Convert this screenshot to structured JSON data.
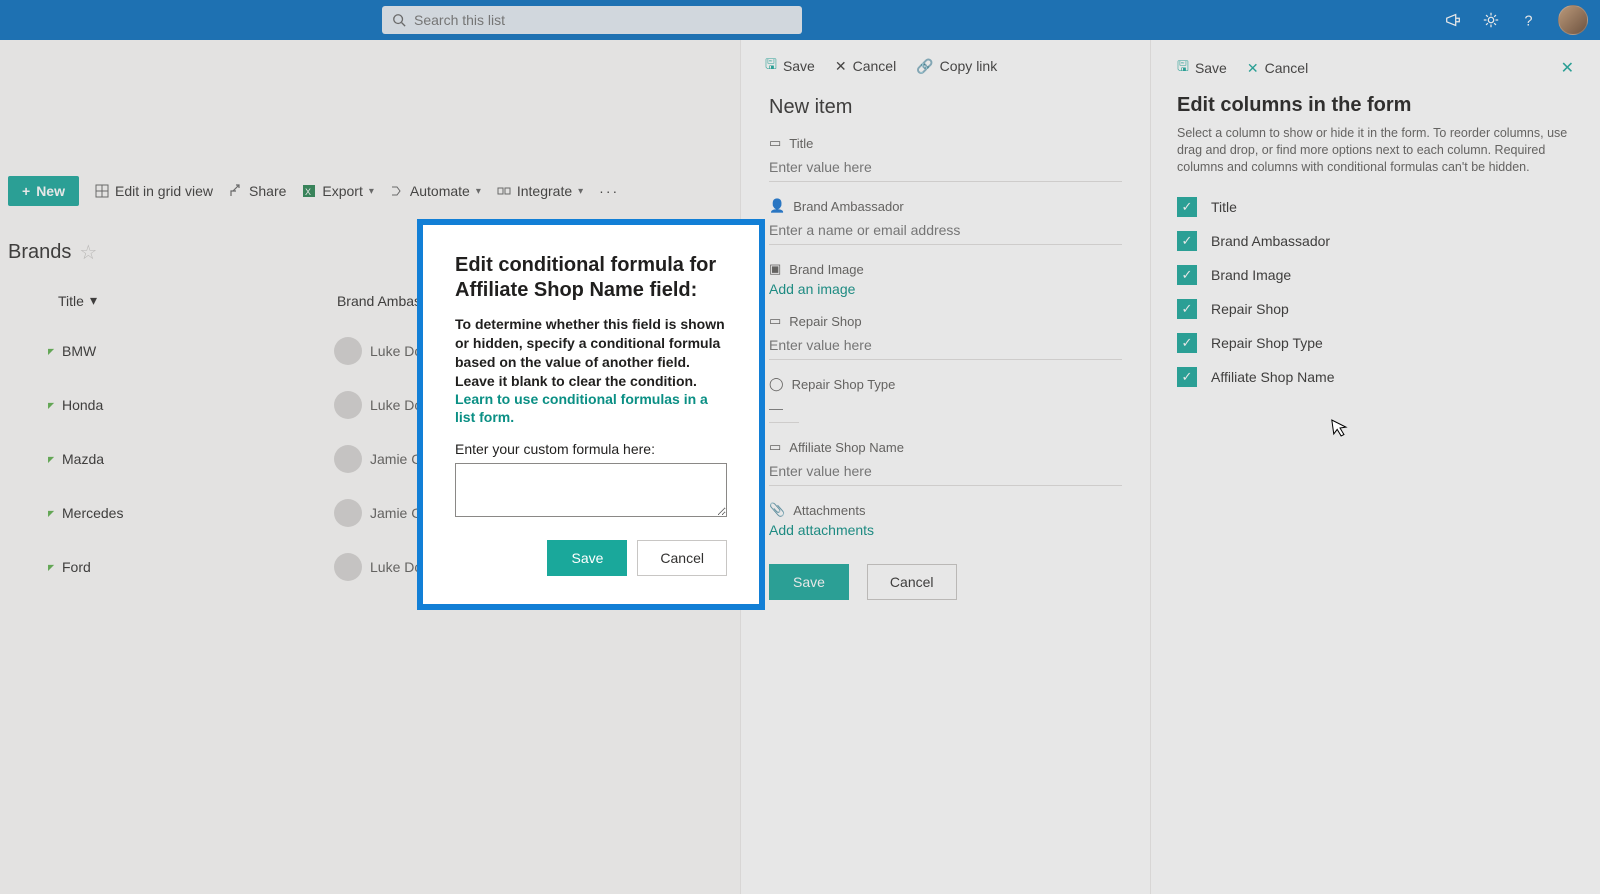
{
  "suite": {
    "search_placeholder": "Search this list"
  },
  "commands": {
    "new": "New",
    "edit_grid": "Edit in grid view",
    "share": "Share",
    "export": "Export",
    "automate": "Automate",
    "integrate": "Integrate"
  },
  "list": {
    "title": "Brands",
    "columns": {
      "c1": "Title",
      "c2": "Brand Ambass..."
    },
    "rows": [
      {
        "title": "BMW",
        "person": "Luke Donald"
      },
      {
        "title": "Honda",
        "person": "Luke Donald"
      },
      {
        "title": "Mazda",
        "person": "Jamie Crust"
      },
      {
        "title": "Mercedes",
        "person": "Jamie Crust"
      },
      {
        "title": "Ford",
        "person": "Luke Donald"
      }
    ]
  },
  "newitem": {
    "cmd_save": "Save",
    "cmd_cancel": "Cancel",
    "cmd_copy": "Copy link",
    "heading": "New item",
    "fields": {
      "title": {
        "label": "Title",
        "placeholder": "Enter value here"
      },
      "brand_ambassador": {
        "label": "Brand Ambassador",
        "placeholder": "Enter a name or email address"
      },
      "brand_image": {
        "label": "Brand Image",
        "link": "Add an image"
      },
      "repair_shop": {
        "label": "Repair Shop",
        "placeholder": "Enter value here"
      },
      "repair_shop_type": {
        "label": "Repair Shop Type",
        "placeholder": "—"
      },
      "affiliate": {
        "label": "Affiliate Shop Name",
        "placeholder": "Enter value here"
      },
      "attachments": {
        "label": "Attachments",
        "link": "Add attachments"
      }
    },
    "save": "Save",
    "cancel": "Cancel"
  },
  "editcols": {
    "cmd_save": "Save",
    "cmd_cancel": "Cancel",
    "title": "Edit columns in the form",
    "desc": "Select a column to show or hide it in the form. To reorder columns, use drag and drop, or find more options next to each column. Required columns and columns with conditional formulas can't be hidden.",
    "items": [
      "Title",
      "Brand Ambassador",
      "Brand Image",
      "Repair Shop",
      "Repair Shop Type",
      "Affiliate Shop Name"
    ]
  },
  "modal": {
    "title": "Edit conditional formula for Affiliate Shop Name field:",
    "desc": "To determine whether this field is shown or hidden, specify a conditional formula based on the value of another field. Leave it blank to clear the condition.",
    "link": "Learn to use conditional formulas in a list form.",
    "label": "Enter your custom formula here:",
    "save": "Save",
    "cancel": "Cancel"
  }
}
